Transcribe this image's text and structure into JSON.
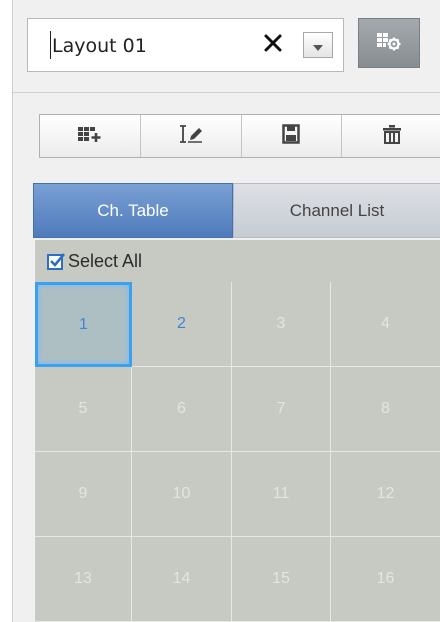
{
  "layout": {
    "name": "Layout 01",
    "clear_symbol": "✕",
    "dropdown_icon": "chevron-down-icon",
    "settings_icon": "layout-settings-icon"
  },
  "toolbar": {
    "buttons": [
      {
        "name": "add-layout-button",
        "icon": "add-layout-icon"
      },
      {
        "name": "rename-layout-button",
        "icon": "rename-icon"
      },
      {
        "name": "save-layout-button",
        "icon": "save-icon"
      },
      {
        "name": "delete-layout-button",
        "icon": "trash-icon"
      }
    ]
  },
  "tabs": [
    {
      "label": "Ch. Table",
      "active": true
    },
    {
      "label": "Channel List",
      "active": false
    }
  ],
  "select_all": {
    "label": "Select All",
    "checked": true
  },
  "channels": {
    "cells": [
      "1",
      "2",
      "3",
      "4",
      "5",
      "6",
      "7",
      "8",
      "9",
      "10",
      "11",
      "12",
      "13",
      "14",
      "15",
      "16"
    ],
    "enabled": [
      "1",
      "2"
    ],
    "selected": "1"
  },
  "colors": {
    "accent": "#4f7bbb",
    "grid_bg": "#c7cac2",
    "enabled_text": "#3a86d6",
    "selection_border": "#3aa0f0"
  }
}
